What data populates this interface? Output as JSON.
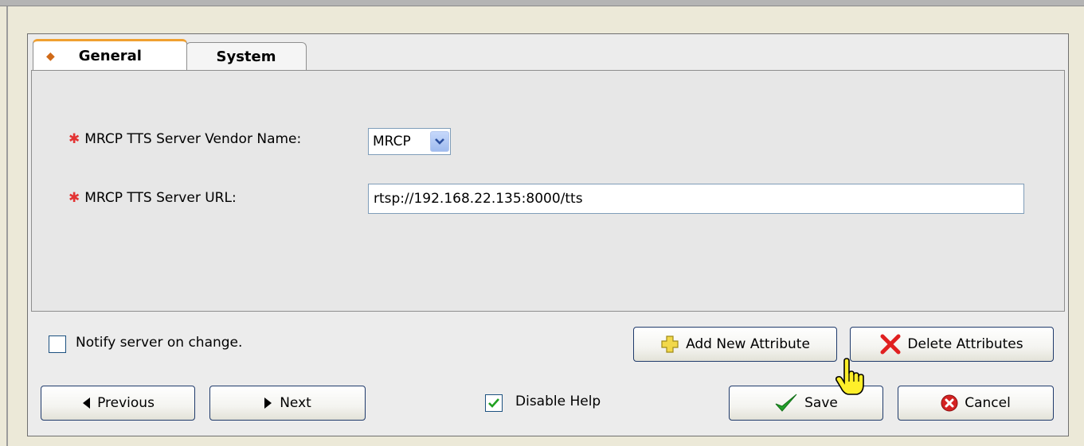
{
  "tabs": [
    {
      "label": "General",
      "active": true
    },
    {
      "label": "System",
      "active": false
    }
  ],
  "form": {
    "vendor_label": "MRCP TTS Server Vendor Name:",
    "vendor_value": "MRCP",
    "url_label": "MRCP TTS Server URL:",
    "url_value": "rtsp://192.168.22.135:8000/tts",
    "required_marker": "✱"
  },
  "notify": {
    "label": "Notify server on change.",
    "checked": false
  },
  "attributes": {
    "add_label": "Add New Attribute",
    "delete_label": "Delete Attributes"
  },
  "navigation": {
    "previous_label": "Previous",
    "next_label": "Next"
  },
  "help": {
    "label": "Disable Help",
    "checked": true
  },
  "actions": {
    "save_label": "Save",
    "cancel_label": "Cancel"
  },
  "colors": {
    "required_star": "#e33333",
    "tab_accent": "#f0a030",
    "button_border": "#1f3a6b"
  },
  "icons": [
    "diamond-icon",
    "dropdown-arrow-icon",
    "plus-icon",
    "delete-x-icon",
    "previous-arrow-icon",
    "next-arrow-icon",
    "checkmark-icon",
    "cancel-icon",
    "hand-cursor-icon"
  ]
}
